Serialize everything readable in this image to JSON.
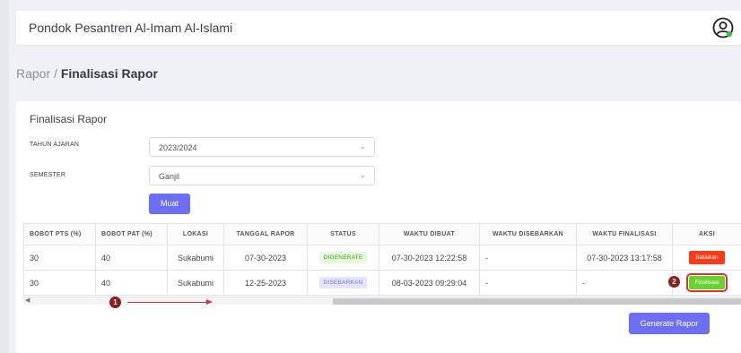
{
  "header": {
    "app_title": "Pondok Pesantren Al-Imam Al-Islami",
    "user_icon": "user-circle-icon"
  },
  "breadcrumb": {
    "parent": "Rapor",
    "separator": " / ",
    "current": "Finalisasi Rapor"
  },
  "card": {
    "title": "Finalisasi Rapor",
    "tahun_label": "TAHUN AJARAN",
    "tahun_value": "2023/2024",
    "semester_label": "SEMESTER",
    "semester_value": "Ganjil",
    "load_button": "Muat"
  },
  "table": {
    "headers": [
      "BOBOT PTS (%)",
      "BOBOT PAT (%)",
      "LOKASI",
      "TANGGAL RAPOR",
      "STATUS",
      "WAKTU DIBUAT",
      "WAKTU DISEBARKAN",
      "WAKTU FINALISASI",
      "AKSI"
    ],
    "rows": [
      {
        "pts": "30",
        "pat": "40",
        "lokasi": "Sukabumi",
        "tanggal": "07-30-2023",
        "status": "DIGENERATE",
        "dibuat": "07-30-2023 12:22:58",
        "disebarkan": "-",
        "finalisasi": "07-30-2023 13:17:58",
        "aksi": "Batalkan"
      },
      {
        "pts": "30",
        "pat": "40",
        "lokasi": "Sukabumi",
        "tanggal": "12-25-2023",
        "status": "DISEBARKAN",
        "dibuat": "08-03-2023 09:29:04",
        "disebarkan": "-",
        "finalisasi": "-",
        "aksi": "Finalisasi"
      }
    ]
  },
  "annotations": {
    "marker_1": "1",
    "marker_2": "2"
  },
  "generate_button": "Generate Rapor",
  "colors": {
    "primary": "#6c6ff5",
    "danger": "#fb3a1a",
    "success": "#69d330",
    "annotation": "#8e1d22"
  }
}
